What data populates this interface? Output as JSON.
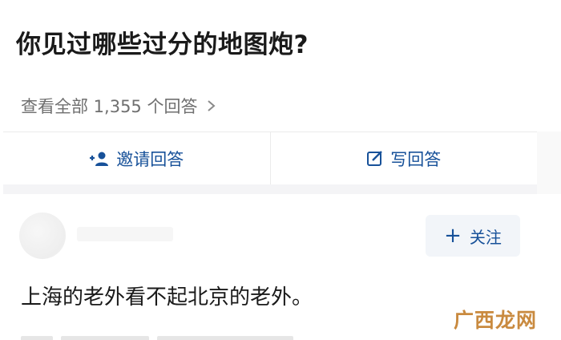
{
  "question": {
    "title": "你见过哪些过分的地图炮?",
    "view_all": "查看全部 1,355 个回答"
  },
  "actions": {
    "invite": {
      "label": "邀请回答",
      "icon": "add-user-icon"
    },
    "write": {
      "label": "写回答",
      "icon": "edit-icon"
    }
  },
  "answer": {
    "follow_label": "关注",
    "text": "上海的老外看不起北京的老外。"
  },
  "watermark": "广西龙网",
  "colors": {
    "accent": "#175199",
    "muted": "#6f6f6f",
    "watermark": "#c98a3f"
  }
}
